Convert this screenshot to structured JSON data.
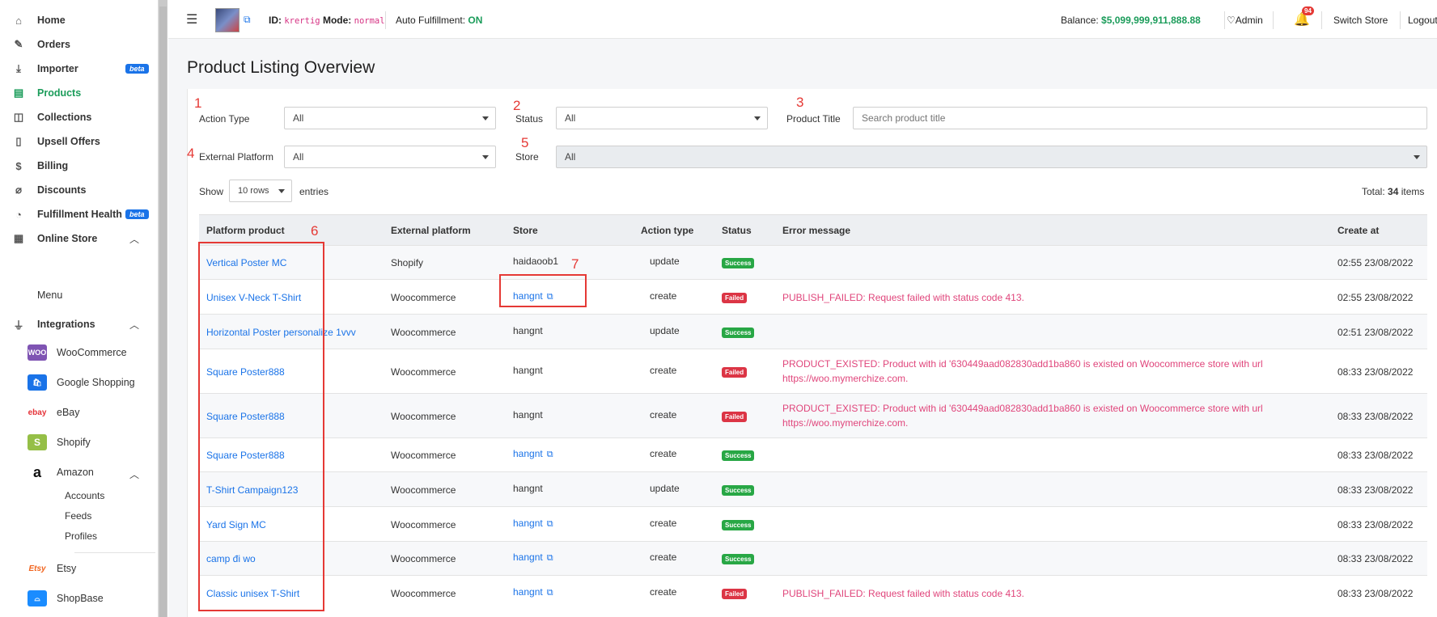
{
  "sidebar": {
    "items": [
      {
        "label": "Home",
        "icon": "home-icon"
      },
      {
        "label": "Orders",
        "icon": "edit-icon"
      },
      {
        "label": "Importer",
        "icon": "download-icon",
        "badge": "beta"
      },
      {
        "label": "Products",
        "icon": "box-icon",
        "active": true
      },
      {
        "label": "Collections",
        "icon": "cube-icon"
      },
      {
        "label": "Upsell Offers",
        "icon": "bookmark-icon"
      },
      {
        "label": "Billing",
        "icon": "dollar-icon"
      },
      {
        "label": "Discounts",
        "icon": "tag-icon"
      },
      {
        "label": "Fulfillment Health",
        "icon": "pie-icon",
        "badge": "beta"
      },
      {
        "label": "Online Store",
        "icon": "store-icon"
      },
      {
        "label": "Integrations",
        "icon": "plug-icon"
      }
    ],
    "online_store_sub": "Menu",
    "integrations": [
      "WooCommerce",
      "Google Shopping",
      "eBay",
      "Shopify",
      "Amazon",
      "Etsy",
      "ShopBase"
    ],
    "amazon_sub": [
      "Accounts",
      "Feeds",
      "Profiles"
    ],
    "logos": {
      "woo": "WOO",
      "ebay": "ebay",
      "etsy": "Etsy"
    }
  },
  "header": {
    "id_label": "ID:",
    "id_value": "krertig",
    "mode_label": "Mode:",
    "mode_value": "normal",
    "auto_label": "Auto Fulfillment:",
    "auto_value": "ON",
    "balance_label": "Balance:",
    "balance_value": "$5,099,999,911,888.88",
    "admin": "Admin",
    "notif_count": "94",
    "switch_store": "Switch Store",
    "logout": "Logout"
  },
  "page": {
    "title": "Product Listing Overview"
  },
  "filters": {
    "action_type_label": "Action Type",
    "action_type_value": "All",
    "status_label": "Status",
    "status_value": "All",
    "product_title_label": "Product Title",
    "product_title_placeholder": "Search product title",
    "external_platform_label": "External Platform",
    "external_platform_value": "All",
    "store_label": "Store",
    "store_value": "All",
    "show_label": "Show",
    "rows_value": "10 rows",
    "entries_label": "entries",
    "total_label": "Total:",
    "total_value": "34",
    "items_label": "items"
  },
  "annotations": [
    "1",
    "2",
    "3",
    "4",
    "5",
    "6",
    "7"
  ],
  "table": {
    "columns": [
      "Platform product",
      "External platform",
      "Store",
      "Action type",
      "Status",
      "Error message",
      "Create at"
    ],
    "rows": [
      {
        "product": "Vertical Poster MC",
        "platform": "Shopify",
        "store": "haidaoob1",
        "store_link": false,
        "action": "update",
        "status": "Success",
        "error": "",
        "created": "02:55 23/08/2022"
      },
      {
        "product": "Unisex V-Neck T-Shirt",
        "platform": "Woocommerce",
        "store": "hangnt",
        "store_link": true,
        "action": "create",
        "status": "Failed",
        "error": "PUBLISH_FAILED: Request failed with status code 413.",
        "created": "02:55 23/08/2022"
      },
      {
        "product": "Horizontal Poster personalize 1vvv",
        "platform": "Woocommerce",
        "store": "hangnt",
        "store_link": false,
        "action": "update",
        "status": "Success",
        "error": "",
        "created": "02:51 23/08/2022"
      },
      {
        "product": "Square Poster888",
        "platform": "Woocommerce",
        "store": "hangnt",
        "store_link": false,
        "action": "create",
        "status": "Failed",
        "error": "PRODUCT_EXISTED: Product with id '630449aad082830add1ba860 is existed on Woocommerce store with url https://woo.mymerchize.com.",
        "created": "08:33 23/08/2022"
      },
      {
        "product": "Square Poster888",
        "platform": "Woocommerce",
        "store": "hangnt",
        "store_link": false,
        "action": "create",
        "status": "Failed",
        "error": "PRODUCT_EXISTED: Product with id '630449aad082830add1ba860 is existed on Woocommerce store with url https://woo.mymerchize.com.",
        "created": "08:33 23/08/2022"
      },
      {
        "product": "Square Poster888",
        "platform": "Woocommerce",
        "store": "hangnt",
        "store_link": true,
        "action": "create",
        "status": "Success",
        "error": "",
        "created": "08:33 23/08/2022"
      },
      {
        "product": "T-Shirt Campaign123",
        "platform": "Woocommerce",
        "store": "hangnt",
        "store_link": false,
        "action": "update",
        "status": "Success",
        "error": "",
        "created": "08:33 23/08/2022"
      },
      {
        "product": "Yard Sign MC",
        "platform": "Woocommerce",
        "store": "hangnt",
        "store_link": true,
        "action": "create",
        "status": "Success",
        "error": "",
        "created": "08:33 23/08/2022"
      },
      {
        "product": "camp đi wo",
        "platform": "Woocommerce",
        "store": "hangnt",
        "store_link": true,
        "action": "create",
        "status": "Success",
        "error": "",
        "created": "08:33 23/08/2022"
      },
      {
        "product": "Classic unisex T-Shirt",
        "platform": "Woocommerce",
        "store": "hangnt",
        "store_link": true,
        "action": "create",
        "status": "Failed",
        "error": "PUBLISH_FAILED: Request failed with status code 413.",
        "created": "08:33 23/08/2022"
      }
    ]
  },
  "colors": {
    "accent": "#1b9c5a",
    "link": "#1a73e8",
    "error": "#e0457b",
    "annotation": "#e53935"
  }
}
